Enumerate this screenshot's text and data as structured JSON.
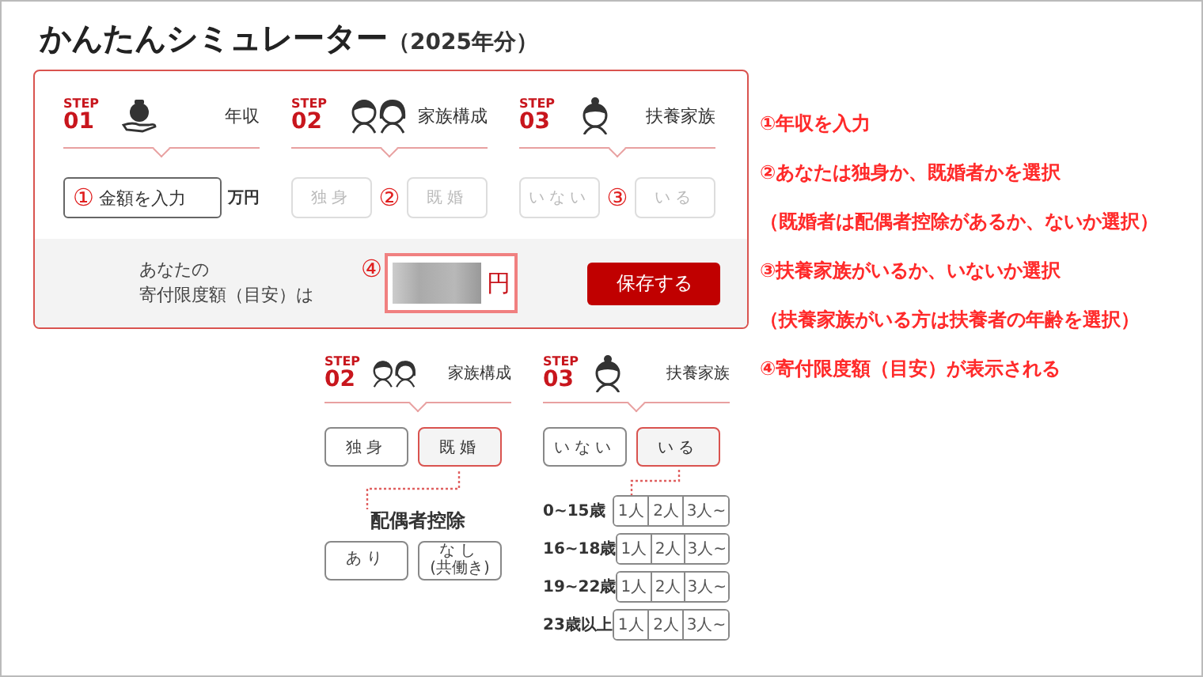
{
  "title": "かんたんシミュレーター",
  "title_suffix": "（2025年分）",
  "simulator": {
    "steps": [
      {
        "kind": "income",
        "step_label": "STEP",
        "number": "01",
        "title": "年収"
      },
      {
        "kind": "family",
        "step_label": "STEP",
        "number": "02",
        "title": "家族構成"
      },
      {
        "kind": "dependents",
        "step_label": "STEP",
        "number": "03",
        "title": "扶養家族"
      }
    ],
    "income_field": {
      "marker": "①",
      "placeholder": "金額を入力",
      "unit": "万円"
    },
    "marital": {
      "marker": "②",
      "options": [
        {
          "label": "独身",
          "selected": false,
          "disabled": true
        },
        {
          "label": "既婚",
          "selected": false,
          "disabled": true
        }
      ]
    },
    "dependents": {
      "marker": "③",
      "options": [
        {
          "label": "いない",
          "selected": false,
          "disabled": true
        },
        {
          "label": "いる",
          "selected": false,
          "disabled": true
        }
      ]
    },
    "result": {
      "label_lines": [
        "あなたの",
        "寄付限度額（目安）は"
      ],
      "marker": "④",
      "unit": "円",
      "save_button": "保存する"
    }
  },
  "notes": [
    {
      "text": "①年収を入力"
    },
    {
      "text": "②あなたは独身か、既婚者かを選択"
    },
    {
      "text": "（既婚者は配偶者控除があるか、ないか選択）"
    },
    {
      "text": "③扶養家族がいるか、いないか選択"
    },
    {
      "text": "（扶養家族がいる方は扶養者の年齢を選択）"
    },
    {
      "text": "④寄付限度額（目安）が表示される"
    }
  ],
  "detail": {
    "marital": {
      "step": {
        "kind": "family",
        "step_label": "STEP",
        "number": "02",
        "title": "家族構成"
      },
      "options": [
        {
          "label": "独身",
          "selected": false
        },
        {
          "label": "既婚",
          "selected": true
        }
      ],
      "spouse_deduction": {
        "title": "配偶者控除",
        "options": [
          {
            "label": "あり"
          },
          {
            "label": "なし",
            "note": "(共働き)"
          }
        ]
      }
    },
    "dependents": {
      "step": {
        "kind": "dependents",
        "step_label": "STEP",
        "number": "03",
        "title": "扶養家族"
      },
      "options": [
        {
          "label": "いない",
          "selected": false
        },
        {
          "label": "いる",
          "selected": true
        }
      ],
      "age_rows": [
        {
          "label": "0~15歳",
          "counts": [
            "1人",
            "2人",
            "3人~"
          ]
        },
        {
          "label": "16~18歳",
          "counts": [
            "1人",
            "2人",
            "3人~"
          ]
        },
        {
          "label": "19~22歳",
          "counts": [
            "1人",
            "2人",
            "3人~"
          ]
        },
        {
          "label": "23歳以上",
          "counts": [
            "1人",
            "2人",
            "3人~"
          ]
        }
      ]
    }
  }
}
